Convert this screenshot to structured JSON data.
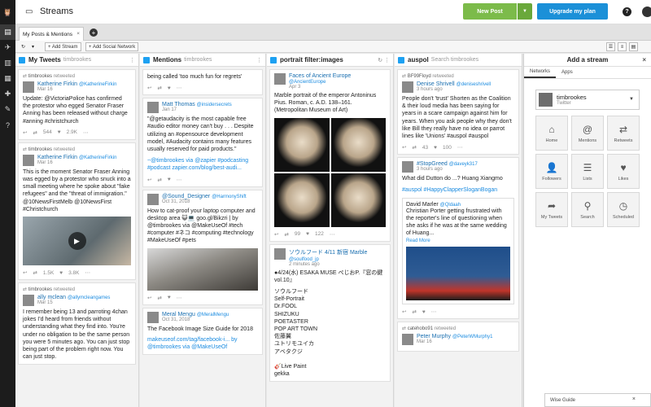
{
  "app": {
    "title": "Streams"
  },
  "topbar": {
    "new_post": "New Post",
    "upgrade": "Upgrade my plan",
    "help": "?"
  },
  "tabs": {
    "main": "My Posts & Mentions",
    "close": "×",
    "add": "+"
  },
  "toolbar": {
    "add_stream": "+ Add Stream",
    "add_network": "+ Add Social Network"
  },
  "columns": [
    {
      "title": "My Tweets",
      "sub": "timbrookes",
      "cards": [
        {
          "rt": "timbrookes",
          "rt_suffix": "retweeted",
          "name": "Katherine Firkin",
          "handle": "@KatherineFirkin",
          "date": "Mar 16",
          "text": "Update: @VictoriaPolice has confirmed the protestor who egged Senator Fraser Anning has been released without charge #anning #christchurch",
          "retweets": "544",
          "likes": "2.9K"
        },
        {
          "rt": "timbrookes",
          "rt_suffix": "retweeted",
          "name": "Katherine Firkin",
          "handle": "@KatherineFirkin",
          "date": "Mar 16",
          "text": "This is the moment Senator Fraser Anning was egged by a protestor who snuck into a small meeting where he spoke about \"fake refugees\" and the \"threat of immigration.\" @10NewsFirstMelb @10NewsFirst #Christchurch",
          "retweets": "1.5K",
          "likes": "3.8K"
        },
        {
          "rt": "timbrookes",
          "rt_suffix": "retweeted",
          "name": "ally mclean",
          "handle": "@allymcleangames",
          "date": "Mar 15",
          "text": "I remember being 13 and parroting 4chan jokes I'd heard from friends without understanding what they find into. You're under no obligation to be the same person you were 5 minutes ago. You can just stop being part of the problem right now. You can just stop."
        }
      ]
    },
    {
      "title": "Mentions",
      "sub": "timbrookes",
      "top_text": "being called 'too much fun for regrets'",
      "cards": [
        {
          "name": "Matt Thomas",
          "handle": "@insidersecrets",
          "date": "Jan 17",
          "text": "\"@getaudacity is the most capable free #audio editor money can't buy . . . Despite utilizing an #opensource development model, #Audacity contains many features usually reserved for paid products.\"",
          "text2": "~@timbrookes via @zapier #podcasting #podcast zapier.com/blog/best-audi..."
        },
        {
          "name": "@Sound_Designer",
          "handle": "@HarmonyShift",
          "date": "Oct 31, 2018",
          "text": "How to cat-proof your laptop computer and desktop area 😺💻 goo.gl/Bikzri | by @timbrookes via @MakeUseOf #tech #computer #ネコ #computing #technology #MakeUseOf #pets"
        },
        {
          "name": "Meral Mengu",
          "handle": "@MeralMengu",
          "date": "Oct 31, 2018",
          "text": "The Facebook Image Size Guide for 2018",
          "text2": "makeuseof.com/tag/facebook-i... by @timbrookes via @MakeUseOf"
        }
      ]
    },
    {
      "title": "portrait filter:images",
      "sub": "",
      "cards": [
        {
          "name": "Faces of Ancient Europe",
          "handle": "@AncientEurope",
          "date": "Apr 3",
          "text": "Marble portrait of the emperor Antoninus Pius. Roman, c. A.D. 138–161. (Metropolitan Museum of Art)",
          "retweets": "99",
          "likes": "122"
        },
        {
          "name": "ソウルフード 4/11 新宿 Marble",
          "handle": "@soulfood_jp",
          "date": "2 minutes ago",
          "text": "●4/24(水) ESAKA MUSE ぺじおP.『窓の鍵vol.10』",
          "lines": [
            "ソウルフード",
            "Self-Portrait",
            "Dr.FOOL",
            "SHIZUKU",
            "POETASTER",
            "POP ART TOWN",
            "佐藤翼",
            "ユトリモユイカ",
            "アベタクジ",
            "",
            "🎸Live Paint",
            "gekka"
          ]
        }
      ]
    },
    {
      "title": "auspol",
      "sub": "Search timbrookes",
      "cards": [
        {
          "rt": "BF99Floyd",
          "rt_suffix": "retweeted",
          "name": "Denise Shrivell",
          "handle": "@deniseshrivell",
          "date": "3 hours ago",
          "text": "People don't 'trust' Shorten as the Coalition & their loud media has been saying for years in a scare campaign against him for years. When you ask people why they don't like Bill they really have no idea or parrot lines like 'Unions' #auspol #auspol",
          "retweets": "43",
          "likes": "100"
        },
        {
          "name": "#StopGreed",
          "handle": "@daveyk317",
          "date": "3 hours ago",
          "text": "What did Dutton do ...? Huang Xiangmo",
          "text2": "#auspol #HappyClapperSloganBogan",
          "quote_name": "David Marler",
          "quote_handle": "@Qldaah",
          "quote_text": "Christian Porter getting frustrated with the reporter's line of questioning when she asks if he was at the same wedding of Huang...",
          "read_more": "Read More"
        },
        {
          "rt": "catehobo91",
          "rt_suffix": "retweeted",
          "name": "Peter Murphy",
          "handle": "@PeterWMurphy1",
          "date": "Mar 16"
        }
      ]
    }
  ],
  "add_panel": {
    "title": "Add a stream",
    "close": "×",
    "tabs": [
      "Networks",
      "Apps"
    ],
    "account_name": "timbrookes",
    "account_type": "Twitter",
    "items": [
      {
        "label": "Home",
        "icon": "home-icon"
      },
      {
        "label": "Mentions",
        "icon": "at-icon"
      },
      {
        "label": "Retweets",
        "icon": "retweet-icon"
      },
      {
        "label": "Followers",
        "icon": "followers-icon"
      },
      {
        "label": "Lists",
        "icon": "lists-icon"
      },
      {
        "label": "Likes",
        "icon": "heart-icon"
      },
      {
        "label": "My Tweets",
        "icon": "share-icon"
      },
      {
        "label": "Search",
        "icon": "search-icon"
      },
      {
        "label": "Scheduled",
        "icon": "clock-icon"
      }
    ]
  },
  "wise_guide": {
    "label": "Wise Guide",
    "close": "×"
  },
  "colors": {
    "accent": "#1b90d8",
    "new_post": "#7cbb4a",
    "rail": "#1c1c1c",
    "link": "#1a8be0"
  }
}
